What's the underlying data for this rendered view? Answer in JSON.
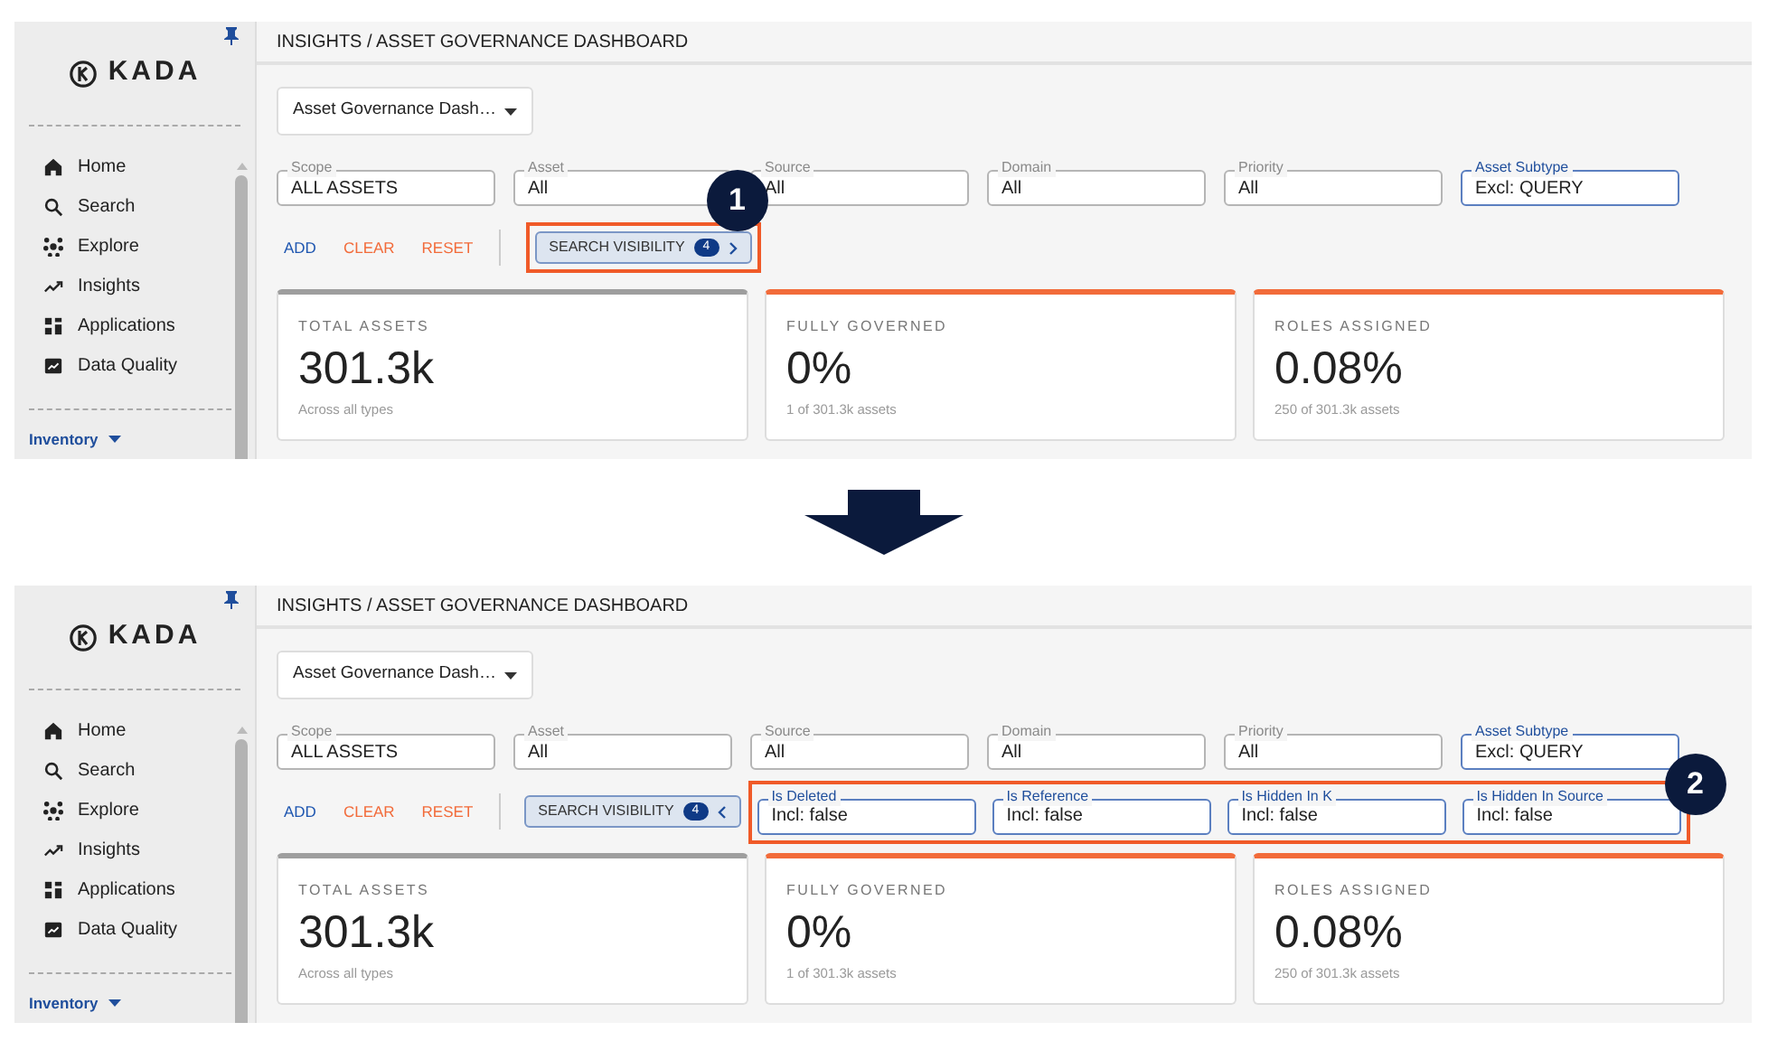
{
  "panels": [
    {
      "sidebar": {
        "logo": "KADA",
        "items": [
          {
            "label": "Home"
          },
          {
            "label": "Search"
          },
          {
            "label": "Explore"
          },
          {
            "label": "Insights"
          },
          {
            "label": "Applications"
          },
          {
            "label": "Data Quality"
          }
        ],
        "section": "Inventory"
      },
      "breadcrumb": "INSIGHTS / ASSET GOVERNANCE DASHBOARD",
      "dashboard_select": "Asset Governance Dash…",
      "filters": [
        {
          "label": "Scope",
          "value": "ALL ASSETS",
          "active": false
        },
        {
          "label": "Asset",
          "value": "All",
          "active": false
        },
        {
          "label": "Source",
          "value": "All",
          "active": false
        },
        {
          "label": "Domain",
          "value": "All",
          "active": false
        },
        {
          "label": "Priority",
          "value": "All",
          "active": false
        },
        {
          "label": "Asset Subtype",
          "value": "Excl: QUERY",
          "active": true
        }
      ],
      "actions": [
        {
          "label": "ADD",
          "color": "#1e56b0"
        },
        {
          "label": "CLEAR",
          "color": "#f26b3a"
        },
        {
          "label": "RESET",
          "color": "#f26b3a"
        }
      ],
      "search_visibility": {
        "label": "SEARCH VISIBILITY",
        "count": "4",
        "expanded": false,
        "callout": "1"
      },
      "cards": [
        {
          "title": "TOTAL ASSETS",
          "value": "301.3k",
          "caption": "Across all types",
          "color": "#9e9e9e"
        },
        {
          "title": "FULLY GOVERNED",
          "value": "0%",
          "caption": "1 of 301.3k assets",
          "color": "#f26b3a"
        },
        {
          "title": "ROLES ASSIGNED",
          "value": "0.08%",
          "caption": "250 of 301.3k assets",
          "color": "#f26b3a"
        }
      ]
    },
    {
      "sidebar": {
        "logo": "KADA",
        "items": [
          {
            "label": "Home"
          },
          {
            "label": "Search"
          },
          {
            "label": "Explore"
          },
          {
            "label": "Insights"
          },
          {
            "label": "Applications"
          },
          {
            "label": "Data Quality"
          }
        ],
        "section": "Inventory"
      },
      "breadcrumb": "INSIGHTS / ASSET GOVERNANCE DASHBOARD",
      "dashboard_select": "Asset Governance Dash…",
      "filters": [
        {
          "label": "Scope",
          "value": "ALL ASSETS",
          "active": false
        },
        {
          "label": "Asset",
          "value": "All",
          "active": false
        },
        {
          "label": "Source",
          "value": "All",
          "active": false
        },
        {
          "label": "Domain",
          "value": "All",
          "active": false
        },
        {
          "label": "Priority",
          "value": "All",
          "active": false
        },
        {
          "label": "Asset Subtype",
          "value": "Excl: QUERY",
          "active": true
        }
      ],
      "actions": [
        {
          "label": "ADD",
          "color": "#1e56b0"
        },
        {
          "label": "CLEAR",
          "color": "#f26b3a"
        },
        {
          "label": "RESET",
          "color": "#f26b3a"
        }
      ],
      "search_visibility": {
        "label": "SEARCH VISIBILITY",
        "count": "4",
        "expanded": true
      },
      "extra_filters": {
        "callout": "2",
        "fields": [
          {
            "label": "Is Deleted",
            "value": "Incl: false",
            "active": true
          },
          {
            "label": "Is Reference",
            "value": "Incl: false",
            "active": true
          },
          {
            "label": "Is Hidden In K",
            "value": "Incl: false",
            "active": true
          },
          {
            "label": "Is Hidden In Source",
            "value": "Incl: false",
            "active": true
          }
        ]
      },
      "cards": [
        {
          "title": "TOTAL ASSETS",
          "value": "301.3k",
          "caption": "Across all types",
          "color": "#9e9e9e"
        },
        {
          "title": "FULLY GOVERNED",
          "value": "0%",
          "caption": "1 of 301.3k assets",
          "color": "#f26b3a"
        },
        {
          "title": "ROLES ASSIGNED",
          "value": "0.08%",
          "caption": "250 of 301.3k assets",
          "color": "#f26b3a"
        }
      ]
    }
  ]
}
